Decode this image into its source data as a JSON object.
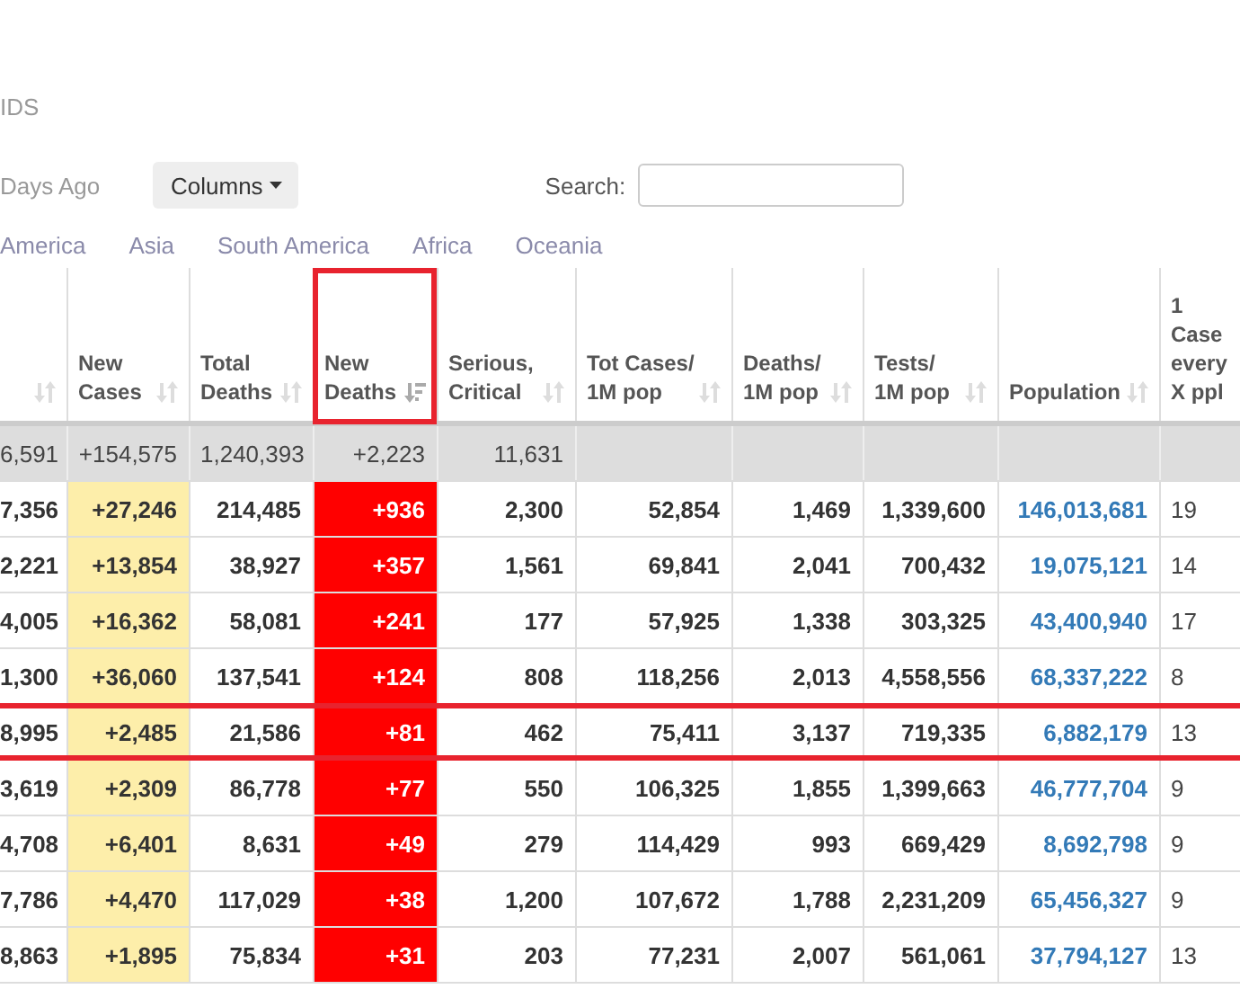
{
  "heading": "IDS",
  "toolbar": {
    "filter_label": "Days Ago",
    "columns_button": "Columns",
    "search_label": "Search:"
  },
  "region_tabs": [
    "America",
    "Asia",
    "South America",
    "Africa",
    "Oceania"
  ],
  "table": {
    "columns": [
      {
        "kind": "plain",
        "highlighted": false,
        "sorted": false,
        "sortable": true
      },
      {
        "label": "New Cases",
        "kind": "new_cases",
        "highlighted": false,
        "sorted": false,
        "sortable": true
      },
      {
        "label": "Total Deaths",
        "kind": "plain",
        "highlighted": false,
        "sorted": false,
        "sortable": true
      },
      {
        "label": "New Deaths",
        "kind": "new_deaths",
        "highlighted": true,
        "sorted": true,
        "sortable": true
      },
      {
        "label": "Serious, Critical",
        "kind": "plain",
        "highlighted": false,
        "sorted": false,
        "sortable": true
      },
      {
        "label": "Tot Cases/ 1M pop",
        "kind": "plain",
        "highlighted": false,
        "sorted": false,
        "sortable": true
      },
      {
        "label": "Deaths/ 1M pop",
        "kind": "plain",
        "highlighted": false,
        "sorted": false,
        "sortable": true
      },
      {
        "label": "Tests/ 1M pop",
        "kind": "plain",
        "highlighted": false,
        "sorted": false,
        "sortable": true
      },
      {
        "label": "Population",
        "kind": "link",
        "highlighted": false,
        "sorted": false,
        "sortable": true
      },
      {
        "label": "1 Case every X ppl",
        "kind": "light",
        "highlighted": false,
        "sortable": false
      }
    ],
    "total_row": [
      "6,591",
      "+154,575",
      "1,240,393",
      "+2,223",
      "11,631"
    ],
    "rows": [
      {
        "highlighted": false,
        "cells": [
          "7,356",
          "+27,246",
          "214,485",
          "+936",
          "2,300",
          "52,854",
          "1,469",
          "1,339,600",
          "146,013,681",
          "19"
        ]
      },
      {
        "highlighted": false,
        "cells": [
          "2,221",
          "+13,854",
          "38,927",
          "+357",
          "1,561",
          "69,841",
          "2,041",
          "700,432",
          "19,075,121",
          "14"
        ]
      },
      {
        "highlighted": false,
        "cells": [
          "4,005",
          "+16,362",
          "58,081",
          "+241",
          "177",
          "57,925",
          "1,338",
          "303,325",
          "43,400,940",
          "17"
        ]
      },
      {
        "highlighted": false,
        "cells": [
          "1,300",
          "+36,060",
          "137,541",
          "+124",
          "808",
          "118,256",
          "2,013",
          "4,558,556",
          "68,337,222",
          "8"
        ]
      },
      {
        "highlighted": true,
        "cells": [
          "8,995",
          "+2,485",
          "21,586",
          "+81",
          "462",
          "75,411",
          "3,137",
          "719,335",
          "6,882,179",
          "13"
        ]
      },
      {
        "highlighted": false,
        "cells": [
          "3,619",
          "+2,309",
          "86,778",
          "+77",
          "550",
          "106,325",
          "1,855",
          "1,399,663",
          "46,777,704",
          "9"
        ]
      },
      {
        "highlighted": false,
        "cells": [
          "4,708",
          "+6,401",
          "8,631",
          "+49",
          "279",
          "114,429",
          "993",
          "669,429",
          "8,692,798",
          "9"
        ]
      },
      {
        "highlighted": false,
        "cells": [
          "7,786",
          "+4,470",
          "117,029",
          "+38",
          "1,200",
          "107,672",
          "1,788",
          "2,231,209",
          "65,456,327",
          "9"
        ]
      },
      {
        "highlighted": false,
        "cells": [
          "8,863",
          "+1,895",
          "75,834",
          "+31",
          "203",
          "77,231",
          "2,007",
          "561,061",
          "37,794,127",
          "13"
        ]
      }
    ]
  }
}
